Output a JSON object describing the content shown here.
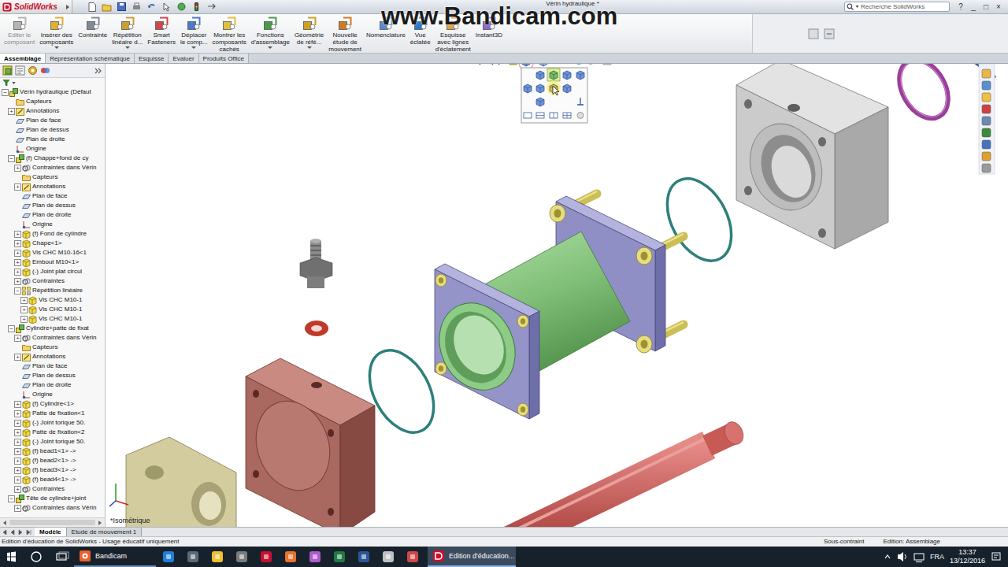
{
  "window": {
    "logo": "SolidWorks",
    "title": "Vérin hydraulique *",
    "controls": [
      "?",
      "_",
      "□",
      "×"
    ]
  },
  "search": {
    "placeholder": "Recherche SolidWorks"
  },
  "watermark": "www.Bandicam.com",
  "ribbon": [
    {
      "lines": [
        "Editer le",
        "composant"
      ],
      "disabled": true,
      "menu": false
    },
    {
      "lines": [
        "Insérer des",
        "composants"
      ],
      "disabled": false,
      "menu": true
    },
    {
      "lines": [
        "Contrainte"
      ],
      "disabled": false,
      "menu": false
    },
    {
      "lines": [
        "Répétition",
        "linéaire d..."
      ],
      "disabled": false,
      "menu": true
    },
    {
      "lines": [
        "Smart",
        "Fasteners"
      ],
      "disabled": false,
      "menu": false
    },
    {
      "lines": [
        "Déplacer",
        "le comp..."
      ],
      "disabled": false,
      "menu": true
    },
    {
      "lines": [
        "Montrer les",
        "composants",
        "cachés"
      ],
      "disabled": false,
      "menu": false
    },
    {
      "lines": [
        "Fonctions",
        "d'assemblage"
      ],
      "disabled": false,
      "menu": true
    },
    {
      "lines": [
        "Géométrie",
        "de réfé..."
      ],
      "disabled": false,
      "menu": true
    },
    {
      "lines": [
        "Nouvelle",
        "étude de",
        "mouvement"
      ],
      "disabled": false,
      "menu": false
    },
    {
      "lines": [
        "Nomenclature"
      ],
      "disabled": false,
      "menu": false
    },
    {
      "lines": [
        "Vue",
        "éclatée"
      ],
      "disabled": false,
      "menu": false
    },
    {
      "lines": [
        "Esquisse",
        "avec lignes",
        "d'éclatement"
      ],
      "disabled": false,
      "menu": true
    },
    {
      "lines": [
        "Instant3D"
      ],
      "disabled": false,
      "menu": false
    }
  ],
  "tabs": [
    {
      "label": "Assemblage",
      "selected": true
    },
    {
      "label": "Représentation schématique",
      "selected": false
    },
    {
      "label": "Esquisse",
      "selected": false
    },
    {
      "label": "Evaluer",
      "selected": false
    },
    {
      "label": "Produits Office",
      "selected": false
    }
  ],
  "tree": [
    {
      "label": "Vérin hydraulique  (Défaut",
      "level": 0,
      "kind": "assembly",
      "toggle": "−"
    },
    {
      "label": "Capteurs",
      "level": 1,
      "kind": "folder"
    },
    {
      "label": "Annotations",
      "level": 1,
      "kind": "annotation",
      "toggle": "+"
    },
    {
      "label": "Plan de face",
      "level": 1,
      "kind": "plane"
    },
    {
      "label": "Plan de dessus",
      "level": 1,
      "kind": "plane"
    },
    {
      "label": "Plan de droite",
      "level": 1,
      "kind": "plane"
    },
    {
      "label": "Origine",
      "level": 1,
      "kind": "origin"
    },
    {
      "label": "(f) Chappe+fond de cy",
      "level": 1,
      "kind": "assembly",
      "toggle": "−"
    },
    {
      "label": "Contraintes dans Vérin",
      "level": 2,
      "kind": "mates",
      "toggle": "+"
    },
    {
      "label": "Capteurs",
      "level": 2,
      "kind": "folder"
    },
    {
      "label": "Annotations",
      "level": 2,
      "kind": "annotation",
      "toggle": "+"
    },
    {
      "label": "Plan de face",
      "level": 2,
      "kind": "plane"
    },
    {
      "label": "Plan de dessus",
      "level": 2,
      "kind": "plane"
    },
    {
      "label": "Plan de droite",
      "level": 2,
      "kind": "plane"
    },
    {
      "label": "Origine",
      "level": 2,
      "kind": "origin"
    },
    {
      "label": "(f) Fond de cylindre",
      "level": 2,
      "kind": "part",
      "toggle": "+"
    },
    {
      "label": "Chape<1>",
      "level": 2,
      "kind": "part",
      "toggle": "+"
    },
    {
      "label": "Vis CHC M10-16<1",
      "level": 2,
      "kind": "part",
      "toggle": "+"
    },
    {
      "label": "Embout M10<1>",
      "level": 2,
      "kind": "part",
      "toggle": "+"
    },
    {
      "label": "(-) Joint plat circul",
      "level": 2,
      "kind": "part",
      "toggle": "+"
    },
    {
      "label": "Contraintes",
      "level": 2,
      "kind": "mates",
      "toggle": "+"
    },
    {
      "label": "Répétition linéaire",
      "level": 2,
      "kind": "pattern",
      "toggle": "−"
    },
    {
      "label": "Vis CHC M10-1",
      "level": 3,
      "kind": "part",
      "toggle": "+"
    },
    {
      "label": "Vis CHC M10-1",
      "level": 3,
      "kind": "part",
      "toggle": "+"
    },
    {
      "label": "Vis CHC M10-1",
      "level": 3,
      "kind": "part",
      "toggle": "+"
    },
    {
      "label": "Cylindre+patte de fixat",
      "level": 1,
      "kind": "assembly",
      "toggle": "−"
    },
    {
      "label": "Contraintes dans Vérin",
      "level": 2,
      "kind": "mates",
      "toggle": "+"
    },
    {
      "label": "Capteurs",
      "level": 2,
      "kind": "folder"
    },
    {
      "label": "Annotations",
      "level": 2,
      "kind": "annotation",
      "toggle": "+"
    },
    {
      "label": "Plan de face",
      "level": 2,
      "kind": "plane"
    },
    {
      "label": "Plan de dessus",
      "level": 2,
      "kind": "plane"
    },
    {
      "label": "Plan de droite",
      "level": 2,
      "kind": "plane"
    },
    {
      "label": "Origine",
      "level": 2,
      "kind": "origin"
    },
    {
      "label": "(f) Cylindre<1>",
      "level": 2,
      "kind": "part",
      "toggle": "+"
    },
    {
      "label": "Patte de fixation<1",
      "level": 2,
      "kind": "part",
      "toggle": "+"
    },
    {
      "label": "(-) Joint torique 50.",
      "level": 2,
      "kind": "part",
      "toggle": "+"
    },
    {
      "label": "Patte de fixation<2",
      "level": 2,
      "kind": "part",
      "toggle": "+"
    },
    {
      "label": "(-) Joint torique 50.",
      "level": 2,
      "kind": "part",
      "toggle": "+"
    },
    {
      "label": "(f) bead1<1> ->",
      "level": 2,
      "kind": "part",
      "toggle": "+"
    },
    {
      "label": "(f) bead2<1> ->",
      "level": 2,
      "kind": "part",
      "toggle": "+"
    },
    {
      "label": "(f) bead3<1> ->",
      "level": 2,
      "kind": "part",
      "toggle": "+"
    },
    {
      "label": "(f) bead4<1> ->",
      "level": 2,
      "kind": "part",
      "toggle": "+"
    },
    {
      "label": "Contraintes",
      "level": 2,
      "kind": "mates",
      "toggle": "+"
    },
    {
      "label": "Tête de cylindre+joint",
      "level": 1,
      "kind": "assembly",
      "toggle": "−"
    },
    {
      "label": "Contraintes dans Vérin",
      "level": 2,
      "kind": "mates",
      "toggle": "+"
    }
  ],
  "viewport": {
    "orientation": "*Isométrique"
  },
  "bottom_tabs": [
    {
      "label": "Modèle",
      "selected": true
    },
    {
      "label": "Etude de mouvement 1",
      "selected": false
    }
  ],
  "status_bar": {
    "message": "Edition d'éducation de SolidWorks - Usage éducatif uniquement",
    "constraint": "Sous-contraint",
    "mode": "Edition: Assemblage"
  },
  "taskbar": {
    "apps": [
      {
        "label": "Bandicam",
        "selected": false
      },
      {
        "label": "Edition d'éducation...",
        "selected": true
      }
    ],
    "language": "FRA",
    "time": "13:37",
    "date": "13/12/2016"
  }
}
